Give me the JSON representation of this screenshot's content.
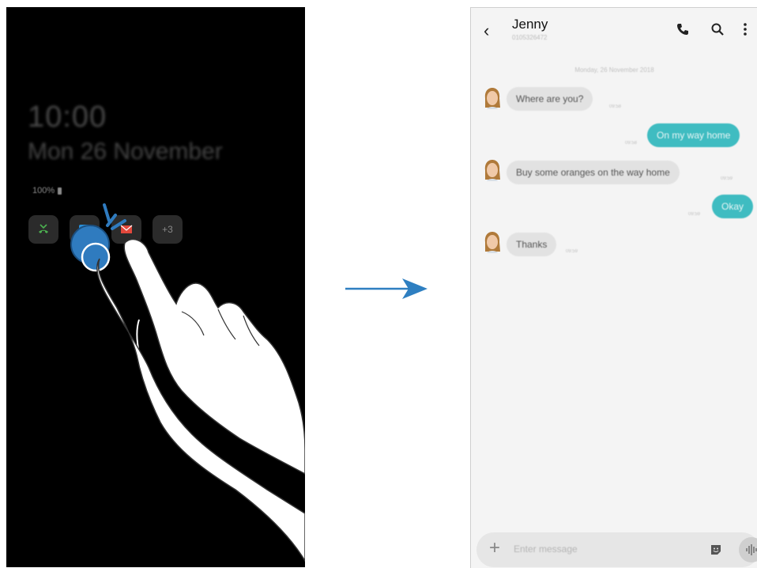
{
  "aod": {
    "time": "10:00",
    "date": "Mon 26 November",
    "battery": "100%",
    "notification_icons": [
      "missed-call-icon",
      "message-icon",
      "email-icon"
    ],
    "more_count": "+3"
  },
  "conversation": {
    "contact_name": "Jenny",
    "contact_number": "0105326472",
    "date_separator": "Monday, 26 November 2018",
    "messages": [
      {
        "direction": "in",
        "text": "Where are you?",
        "time": "09:58"
      },
      {
        "direction": "out",
        "text": "On my way home",
        "time": "09:58"
      },
      {
        "direction": "in",
        "text": "Buy some oranges on the way home",
        "time": "09:59"
      },
      {
        "direction": "out",
        "text": "Okay",
        "time": "09:59"
      },
      {
        "direction": "in",
        "text": "Thanks",
        "time": "09:59"
      }
    ],
    "composer_placeholder": "Enter message"
  },
  "colors": {
    "outgoing_bubble": "#3fbcc1",
    "incoming_bubble": "#e2e2e2",
    "arrow": "#2e7fc1",
    "touch": "#2f7bbf"
  }
}
